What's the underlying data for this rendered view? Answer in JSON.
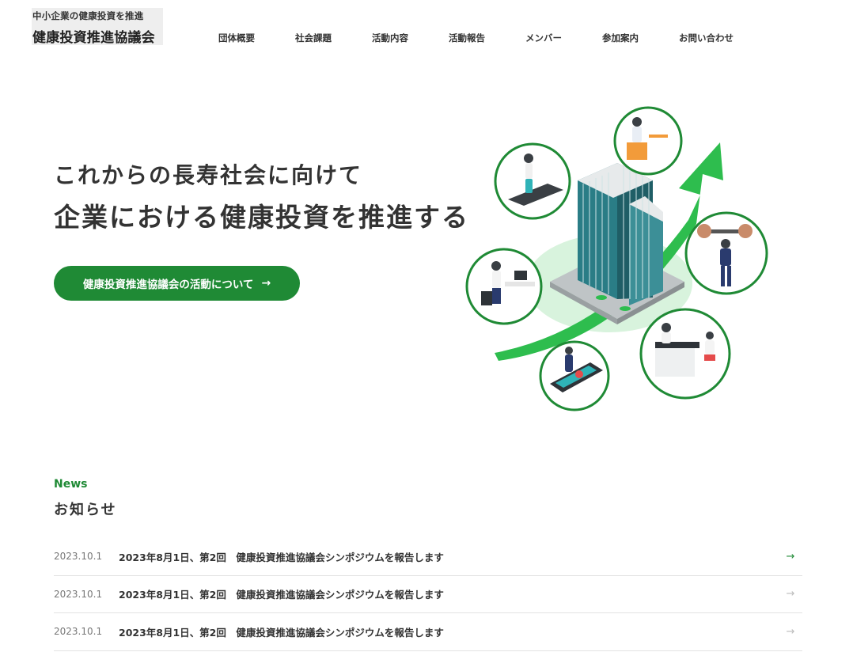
{
  "site": {
    "tagline": "中小企業の健康投資を推進",
    "name": "健康投資推進協議会"
  },
  "nav": {
    "items": [
      {
        "label": "団体概要"
      },
      {
        "label": "社会課題"
      },
      {
        "label": "活動内容"
      },
      {
        "label": "活動報告"
      },
      {
        "label": "メンバー"
      },
      {
        "label": "参加案内"
      },
      {
        "label": "お問い合わせ"
      }
    ]
  },
  "hero": {
    "line1": "これからの長寿社会に向けて",
    "line2": "企業における健康投資を推進する",
    "cta_label": "健康投資推進協議会の活動について",
    "cta_icon": "arrow-right-icon",
    "illustration_icons": [
      "treadmill-person",
      "laptop-person",
      "office-building",
      "weightlifter",
      "desk-stretch-person",
      "phone-health-app",
      "doctor-consultation"
    ]
  },
  "news": {
    "label_en": "News",
    "label_jp": "お知らせ",
    "items": [
      {
        "date": "2023.10.1",
        "title": "2023年8月1日、第2回　健康投資推進協議会シンポジウムを報告します"
      },
      {
        "date": "2023.10.1",
        "title": "2023年8月1日、第2回　健康投資推進協議会シンポジウムを報告します"
      },
      {
        "date": "2023.10.1",
        "title": "2023年8月1日、第2回　健康投資推進協議会シンポジウムを報告します"
      }
    ]
  },
  "colors": {
    "accent": "#1f8a35",
    "arrow_green": "#2ebd4e",
    "circle_border": "#1f8a35",
    "text": "#333333"
  }
}
